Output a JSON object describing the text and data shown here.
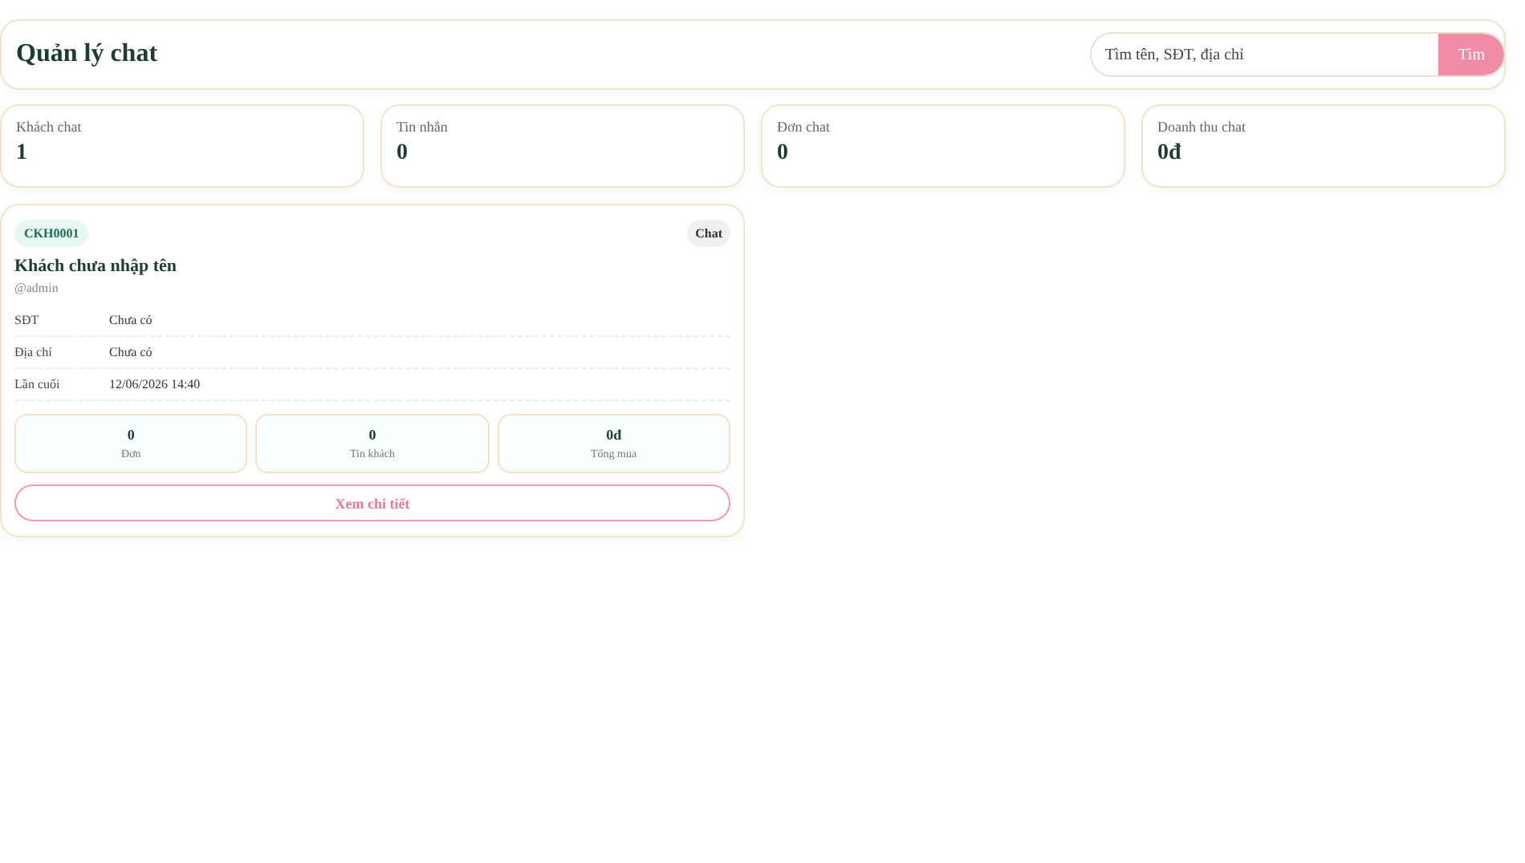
{
  "header": {
    "title": "Quản lý chat",
    "search": {
      "placeholder": "Tìm tên, SĐT, địa chỉ"
    },
    "search_button": "Tìm"
  },
  "stats": [
    {
      "label": "Khách chat",
      "value": "1"
    },
    {
      "label": "Tin nhắn",
      "value": "0"
    },
    {
      "label": "Đơn chat",
      "value": "0"
    },
    {
      "label": "Doanh thu chat",
      "value": "0đ"
    }
  ],
  "customers": [
    {
      "code": "CKH0001",
      "badge": "Chat",
      "name": "Khách chưa nhập tên",
      "username": "@admin",
      "fields": [
        {
          "label": "SĐT",
          "value": "Chưa có"
        },
        {
          "label": "Địa chỉ",
          "value": "Chưa có"
        },
        {
          "label": "Lần cuối",
          "value": "12/06/2026 14:40"
        }
      ],
      "metrics": [
        {
          "value": "0",
          "label": "Đơn"
        },
        {
          "value": "0",
          "label": "Tin khách"
        },
        {
          "value": "0đ",
          "label": "Tổng mua"
        }
      ],
      "action": "Xem chi tiết"
    }
  ]
}
